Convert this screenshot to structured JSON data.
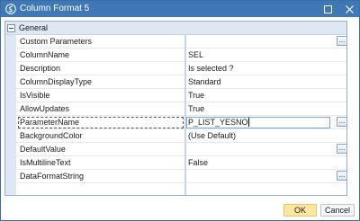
{
  "window": {
    "title": "Column Format 5",
    "maximize_icon": "maximize-icon",
    "close_icon": "close-icon"
  },
  "grid": {
    "category": "General",
    "rows": [
      {
        "name": "Custom Parameters",
        "value": "",
        "has_button": true
      },
      {
        "name": "ColumnName",
        "value": "SEL",
        "has_button": false
      },
      {
        "name": "Description",
        "value": "Is selected ?",
        "has_button": false
      },
      {
        "name": "ColumnDisplayType",
        "value": "Standard",
        "has_button": false
      },
      {
        "name": "IsVisible",
        "value": "True",
        "has_button": false
      },
      {
        "name": "AllowUpdates",
        "value": "True",
        "has_button": false
      },
      {
        "name": "ParameterName",
        "value": "P_LIST_YESNO",
        "has_button": true,
        "selected": true
      },
      {
        "name": "BackgroundColor",
        "value": "(Use Default)",
        "has_button": false
      },
      {
        "name": "DefaultValue",
        "value": "",
        "has_button": true
      },
      {
        "name": "IsMultilineText",
        "value": "False",
        "has_button": false
      },
      {
        "name": "DataFormatString",
        "value": "",
        "has_button": true
      }
    ],
    "button_label": "..."
  },
  "footer": {
    "ok_label": "OK",
    "cancel_label": "Cancel"
  },
  "colors": {
    "titlebar": "#3f78b5",
    "ok_button": "#ffe7a2",
    "category_band": "#dde8f4"
  }
}
